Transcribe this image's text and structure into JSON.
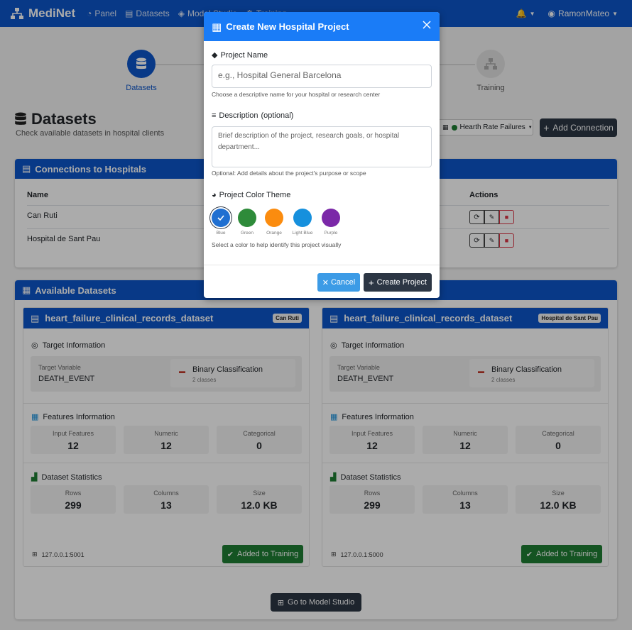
{
  "navbar": {
    "brand": "MediNet",
    "links": [
      "Panel",
      "Datasets",
      "Model Studio",
      "Training"
    ],
    "user": "RamonMateo"
  },
  "stepper": [
    {
      "label": "Datasets",
      "state": "active"
    },
    {
      "label": "Training",
      "state": "inactive"
    }
  ],
  "page": {
    "title": "Datasets",
    "subtitle": "Check available datasets in hospital clients",
    "dataset_select": "Hearth Rate Failures",
    "add_connection": "Add Connection"
  },
  "connections": {
    "header": "Connections to Hospitals",
    "col_name": "Name",
    "col_actions": "Actions",
    "rows": [
      {
        "name": "Can Ruti"
      },
      {
        "name": "Hospital de Sant Pau"
      }
    ]
  },
  "datasets": {
    "header": "Available Datasets",
    "items": [
      {
        "name": "heart_failure_clinical_records_dataset",
        "hospital": "Can Ruti",
        "target_title": "Target Information",
        "target_label": "Target Variable",
        "target_value": "DEATH_EVENT",
        "classification": "Binary Classification",
        "classes": "2 classes",
        "features_title": "Features Information",
        "input_label": "Input Features",
        "input_value": "12",
        "numeric_label": "Numeric",
        "numeric_value": "12",
        "categorical_label": "Categorical",
        "categorical_value": "0",
        "stats_title": "Dataset Statistics",
        "rows_label": "Rows",
        "rows_value": "299",
        "cols_label": "Columns",
        "cols_value": "13",
        "size_label": "Size",
        "size_value": "12.0 KB",
        "host": "127.0.0.1:5001",
        "status_button": "Added to Training"
      },
      {
        "name": "heart_failure_clinical_records_dataset",
        "hospital": "Hospital de Sant Pau",
        "target_title": "Target Information",
        "target_label": "Target Variable",
        "target_value": "DEATH_EVENT",
        "classification": "Binary Classification",
        "classes": "2 classes",
        "features_title": "Features Information",
        "input_label": "Input Features",
        "input_value": "12",
        "numeric_label": "Numeric",
        "numeric_value": "12",
        "categorical_label": "Categorical",
        "categorical_value": "0",
        "stats_title": "Dataset Statistics",
        "rows_label": "Rows",
        "rows_value": "299",
        "cols_label": "Columns",
        "cols_value": "13",
        "size_label": "Size",
        "size_value": "12.0 KB",
        "host": "127.0.0.1:5000",
        "status_button": "Added to Training"
      }
    ],
    "go_button": "Go to Model Studio"
  },
  "modal": {
    "title": "Create New Hospital Project",
    "name_label": "Project Name",
    "name_placeholder": "e.g., Hospital General Barcelona",
    "name_help": "Choose a descriptive name for your hospital or research center",
    "desc_label": "Description",
    "desc_optional": "(optional)",
    "desc_placeholder": "Brief description of the project, research goals, or hospital department...",
    "desc_help": "Optional: Add details about the project's purpose or scope",
    "color_label": "Project Color Theme",
    "colors": [
      {
        "label": "Blue",
        "hex": "#1f6fd1",
        "selected": true
      },
      {
        "label": "Green",
        "hex": "#2e8b3a",
        "selected": false
      },
      {
        "label": "Orange",
        "hex": "#fb8c0f",
        "selected": false
      },
      {
        "label": "Light Blue",
        "hex": "#1690dd",
        "selected": false
      },
      {
        "label": "Purple",
        "hex": "#7b28a8",
        "selected": false
      }
    ],
    "color_help": "Select a color to help identify this project visually",
    "cancel": "Cancel",
    "create": "Create Project"
  }
}
